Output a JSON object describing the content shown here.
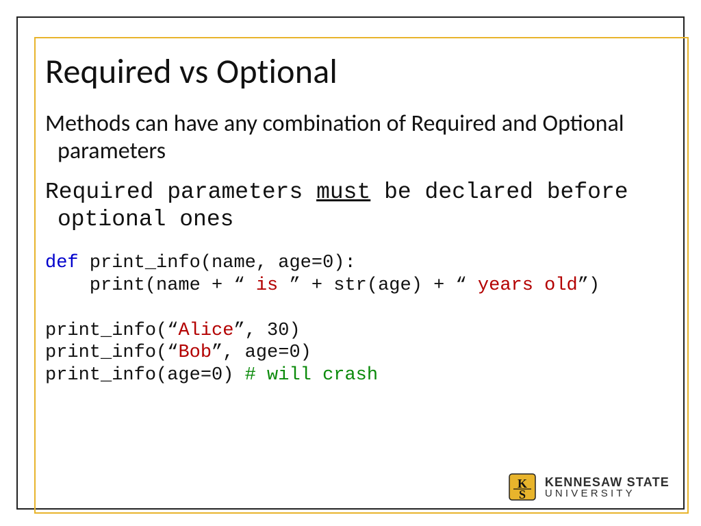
{
  "title": "Required vs Optional",
  "body1": "Methods can have any combination of Required and Optional parameters",
  "body2_prefix": "Required parameters ",
  "body2_underlined": "must",
  "body2_suffix": " be declared before optional ones",
  "code": {
    "l1_kw": "def",
    "l1_rest": " print_info(name, age=0):",
    "l2_a": "    print(name + “ ",
    "l2_b": "is",
    "l2_c": " ” + str(age) + “ ",
    "l2_d": "years old",
    "l2_e": "”)",
    "l3": "",
    "l4_a": "print_info(“",
    "l4_b": "Alice",
    "l4_c": "”, 30)",
    "l5_a": "print_info(“",
    "l5_b": "Bob",
    "l5_c": "”, age=0)",
    "l6_a": "print_info(age=0) ",
    "l6_b": "# will crash"
  },
  "logo": {
    "line1": "KENNESAW STATE",
    "line2": "UNIVERSITY"
  }
}
